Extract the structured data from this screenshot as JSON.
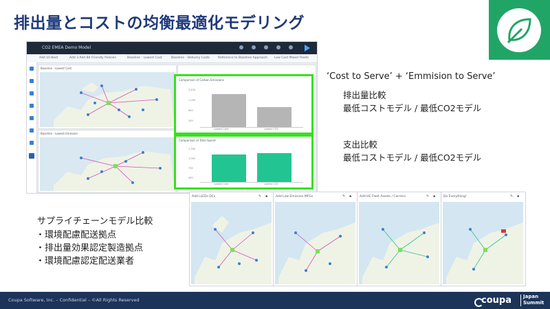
{
  "slide": {
    "title": "排出量とコストの均衡最適化モデリング",
    "footer": "Coupa Software, Inc. – Confidential – ©All Rights Reserved",
    "brand": "coupa",
    "event_line1": "Japan",
    "event_line2": "Summit",
    "colors": {
      "title": "#1f3a7a",
      "accent_green": "#21a566",
      "footer_bg": "#1c3459",
      "highlight": "#38e01e",
      "bar_teal": "#22c592",
      "bar_gray": "#b5b5b5"
    }
  },
  "app": {
    "window_title": "CO2 EMEA Demo Model",
    "tabs": [
      "Add 10 Best",
      "Add 3 Add B4 Friendly Policies",
      "Baseline - Lowest Cost",
      "Baseline - Delivery Costs",
      "Reference to Baseline Approach",
      "Low Cost Mixed Fleets"
    ],
    "panels": {
      "map_top": "Baseline - Lowest Cost",
      "map_bottom": "Baseline - Lowest Emission",
      "chart_top": "Comparison of Carbon Emissions",
      "chart_bottom": "Comparison of Total Spend"
    },
    "side_icons": [
      "home-icon",
      "folder-icon",
      "share-icon",
      "map-icon",
      "chart-icon",
      "truck-icon",
      "grid-icon",
      "list-icon",
      "active-icon"
    ]
  },
  "chart_data": [
    {
      "type": "bar",
      "title": "Comparison of Carbon Emissions",
      "categories": [
        "Lowest Cost",
        "Lowest CO2"
      ],
      "values": [
        1200,
        720
      ],
      "ylim": [
        0,
        1500
      ],
      "yticks": [
        "1,400",
        "1,000",
        "600",
        "200"
      ],
      "color": "#b5b5b5"
    },
    {
      "type": "bar",
      "title": "Comparison of Total Spend",
      "categories": [
        "Lowest Cost",
        "Lowest CO2"
      ],
      "values": [
        1090,
        1120
      ],
      "ylim": [
        0,
        1400
      ],
      "yticks": [
        "1,300",
        "1,000",
        "700",
        "400"
      ],
      "color": "#22c592"
    }
  ],
  "right_text": {
    "heading": "‘Cost to Serve’ + ‘Emmision to Serve’",
    "block1_line1": "排出量比較",
    "block1_line2": "最低コストモデル / 最低CO2モデル",
    "block2_line1": "支出比較",
    "block2_line2": "最低コストモデル / 最低CO2モデル"
  },
  "bottom_maps": [
    {
      "title": "Add LLEDs DCs"
    },
    {
      "title": "Add Low Emission MFGs"
    },
    {
      "title": "Add HE Fleet Assets / Carriers"
    },
    {
      "title": "Do Everything!"
    }
  ],
  "bullets": {
    "heading": "サプライチェーンモデル比較",
    "items": [
      "・環境配慮配送拠点",
      "・排出量効果認定製造拠点",
      "・環境配慮認定配送業者"
    ]
  }
}
